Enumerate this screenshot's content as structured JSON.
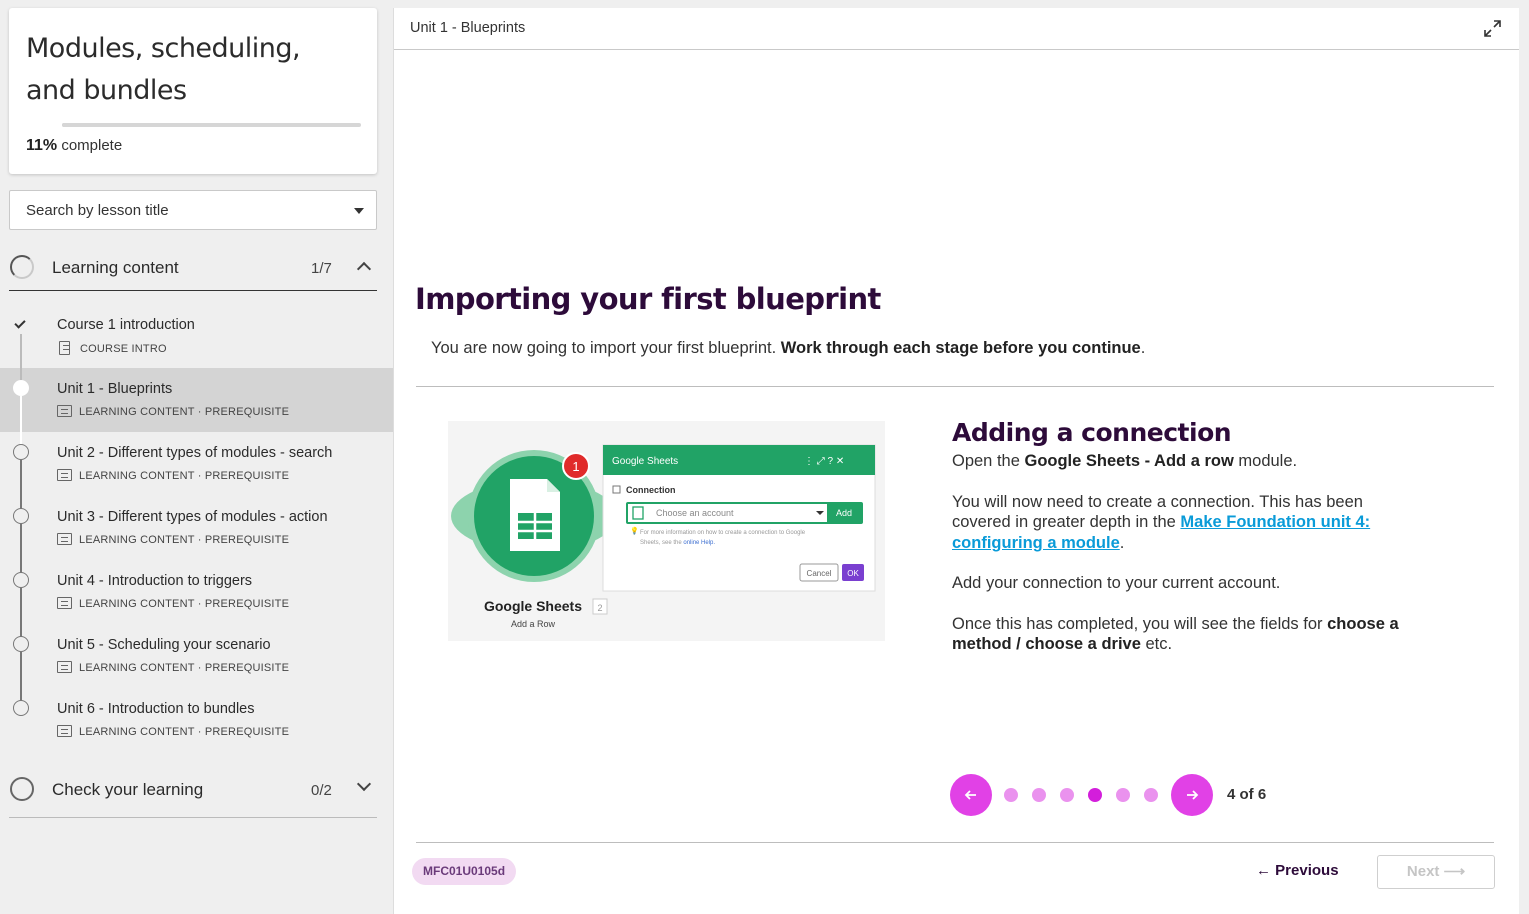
{
  "sidebar": {
    "course_title": "Modules, scheduling, and bundles",
    "progress_percent": "11%",
    "progress_label": "complete",
    "progress_value": 0.11,
    "search": {
      "label": "Search by lesson title"
    },
    "sections": [
      {
        "label": "Learning content",
        "count": "1/7",
        "expanded": true
      },
      {
        "label": "Check your learning",
        "count": "0/2",
        "expanded": false
      }
    ],
    "lessons": [
      {
        "title": "Course 1 introduction",
        "meta": "COURSE INTRO",
        "status": "done"
      },
      {
        "title": "Unit 1 - Blueprints",
        "meta": "LEARNING CONTENT · PREREQUISITE",
        "status": "active"
      },
      {
        "title": "Unit 2 - Different types of modules - search",
        "meta": "LEARNING CONTENT · PREREQUISITE",
        "status": "todo"
      },
      {
        "title": "Unit 3 - Different types of modules - action",
        "meta": "LEARNING CONTENT · PREREQUISITE",
        "status": "todo"
      },
      {
        "title": "Unit 4 - Introduction to triggers",
        "meta": "LEARNING CONTENT · PREREQUISITE",
        "status": "todo"
      },
      {
        "title": "Unit 5 - Scheduling your scenario",
        "meta": "LEARNING CONTENT · PREREQUISITE",
        "status": "todo"
      },
      {
        "title": "Unit 6 - Introduction to bundles",
        "meta": "LEARNING CONTENT · PREREQUISITE",
        "status": "todo"
      }
    ]
  },
  "main": {
    "breadcrumb": "Unit 1 - Blueprints",
    "heading": "Importing your first blueprint",
    "intro_plain": "You are now going to import your first blueprint. ",
    "intro_bold": "Work through each stage before you continue",
    "intro_end": ".",
    "slide": {
      "heading": "Adding a connection",
      "p1_a": "Open the ",
      "p1_b": "Google Sheets - Add a row",
      "p1_c": " module.",
      "p2_a": "You will now need to create a connection. This has been covered in greater depth in the ",
      "p2_link": "Make Foundation unit 4: configuring a module",
      "p2_c": ".",
      "p3": "Add your connection to your current account.",
      "p4_a": "Once this has completed, you will see the fields for ",
      "p4_b": "choose a method / choose a drive",
      "p4_c": " etc."
    },
    "illustration": {
      "badge": "1",
      "app_name": "Google Sheets",
      "app_num": "2",
      "app_sub": "Add a Row",
      "dialog_title": "Google Sheets",
      "connection_label": "Connection",
      "select_placeholder": "Choose an account",
      "add_label": "Add",
      "help_text_1": "For more information on how to create a connection to Google",
      "help_text_2": "Sheets, see the",
      "help_link": "online Help.",
      "cancel_label": "Cancel",
      "ok_label": "OK"
    },
    "carousel": {
      "current": 4,
      "total": 6,
      "pager": "4 of 6"
    },
    "code": "MFC01U0105d",
    "prev_label": "Previous",
    "next_label": "Next",
    "colors": {
      "accent": "#e141e6",
      "heading": "#2d0b3a",
      "link": "#0a9bd8",
      "sheets_green": "#21a366"
    }
  }
}
